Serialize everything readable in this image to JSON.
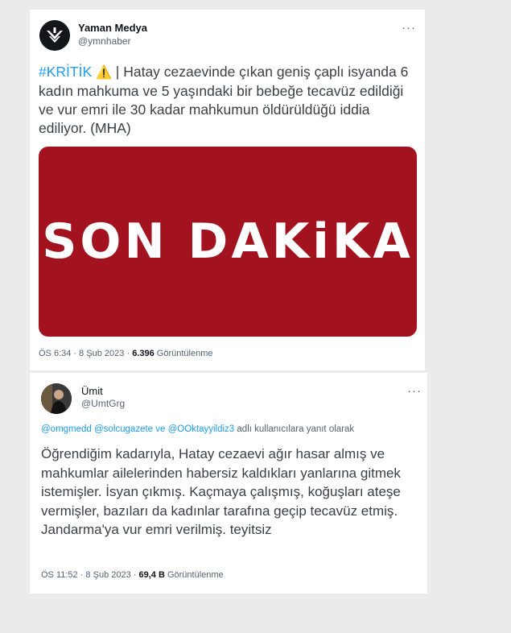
{
  "tweet1": {
    "name": "Yaman Medya",
    "handle": "@ymnhaber",
    "more": "···",
    "hashtag": "#KRİTİK",
    "warning_emoji": "⚠️",
    "text": " | Hatay cezaevinde çıkan geniş çaplı isyanda 6 kadın mahkuma ve 5 yaşındaki bir bebeğe tecavüz edildiği ve vur emri ile 30 kadar mahkumun öldürüldüğü iddia ediliyor. (MHA)",
    "banner_text": "SON DAKiKA",
    "banner_color": "#a3131f",
    "time": "ÖS 6:34 · 8 Şub 2023 · ",
    "views": "6.396",
    "views_label": " Görüntülenme"
  },
  "tweet2": {
    "name": "Ümit",
    "handle": "@UmtGrg",
    "more": "···",
    "mentions": "@omgmedd @solcugazete ve @OOktayyildiz3",
    "reply_suffix": " adlı kullanıcılara yanıt olarak",
    "text": "Öğrendiğim kadarıyla, Hatay cezaevi ağır hasar almış ve mahkumlar ailelerinden habersiz kaldıkları yanlarına gitmek istemişler. İsyan çıkmış. Kaçmaya çalışmış, koğuşları ateşe vermişler, bazıları da kadınlar tarafına geçip tecavüz etmiş. Jandarma'ya vur emri verilmiş. teyitsiz",
    "time": "ÖS 11:52 · 8 Şub 2023 · ",
    "views": "69,4 B",
    "views_label": " Görüntülenme"
  },
  "colors": {
    "link": "#1d9bf0",
    "secondary_text": "#536471",
    "page_background": "#ebebeb"
  }
}
